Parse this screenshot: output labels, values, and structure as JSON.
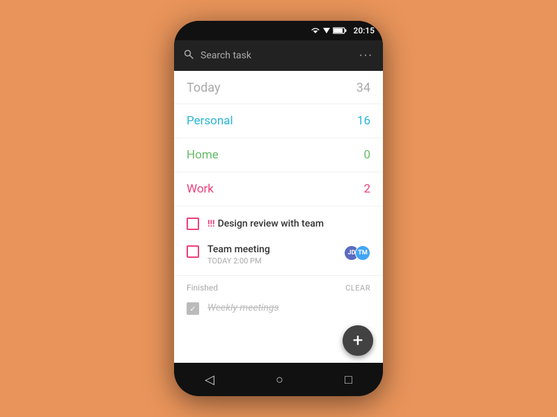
{
  "status_bar": {
    "time": "20:15"
  },
  "search": {
    "placeholder": "Search task"
  },
  "today": {
    "label": "Today",
    "count": "34"
  },
  "categories": [
    {
      "name": "Personal",
      "count": "16",
      "color_class": "personal"
    },
    {
      "name": "Home",
      "count": "0",
      "color_class": "home"
    },
    {
      "name": "Work",
      "count": "2",
      "color_class": "work"
    }
  ],
  "tasks": [
    {
      "id": "task-1",
      "priority": "!!!",
      "title": "Design review with team",
      "subtitle": null,
      "has_avatar": false,
      "finished": false
    },
    {
      "id": "task-2",
      "priority": null,
      "title": "Team meeting",
      "subtitle": "TODAY 2:00 PM",
      "has_avatar": true,
      "finished": false
    }
  ],
  "finished": {
    "label": "Finished",
    "clear_label": "CLEAR",
    "tasks": [
      {
        "title": "Weekly meetings"
      }
    ]
  },
  "nav": {
    "back": "◁",
    "home": "○",
    "recents": "□"
  },
  "fab": {
    "icon": "+"
  }
}
